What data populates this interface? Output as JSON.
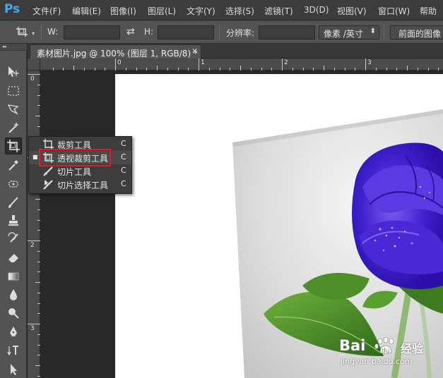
{
  "app": {
    "logo": "Ps"
  },
  "menu": [
    "文件(F)",
    "编辑(E)",
    "图像(I)",
    "图层(L)",
    "文字(Y)",
    "选择(S)",
    "滤镜(T)",
    "3D(D)",
    "视图(V)",
    "窗口(W)",
    "帮助"
  ],
  "options": {
    "w_label": "W:",
    "w_value": "",
    "h_label": "H:",
    "h_value": "",
    "resolution_label": "分辨率:",
    "resolution_value": "",
    "unit_select": "像素 /英寸",
    "front_image_button": "前面的图像"
  },
  "document": {
    "tab_title": "素材图片.jpg @ 100% (图层 1, RGB/8) *",
    "close_glyph": "✕"
  },
  "rulers": {
    "horizontal_labels": [
      "0",
      "1",
      "2",
      "3"
    ],
    "vertical_labels": [
      "0",
      "1",
      "2",
      "3"
    ]
  },
  "flyout": {
    "items": [
      {
        "label": "裁剪工具",
        "shortcut": "C",
        "selected": false,
        "icon": "crop-icon"
      },
      {
        "label": "透视裁剪工具",
        "shortcut": "C",
        "selected": true,
        "icon": "perspective-crop-icon"
      },
      {
        "label": "切片工具",
        "shortcut": "C",
        "selected": false,
        "icon": "slice-icon"
      },
      {
        "label": "切片选择工具",
        "shortcut": "C",
        "selected": false,
        "icon": "slice-select-icon"
      }
    ]
  },
  "watermark": {
    "brand": "Bai",
    "brand_cn": "经验",
    "url": "jingyan.baidu.com"
  },
  "colors": {
    "highlight": "#e31c23",
    "panel": "#535353",
    "workspace": "#282828",
    "rose": "#3b1cc4"
  }
}
